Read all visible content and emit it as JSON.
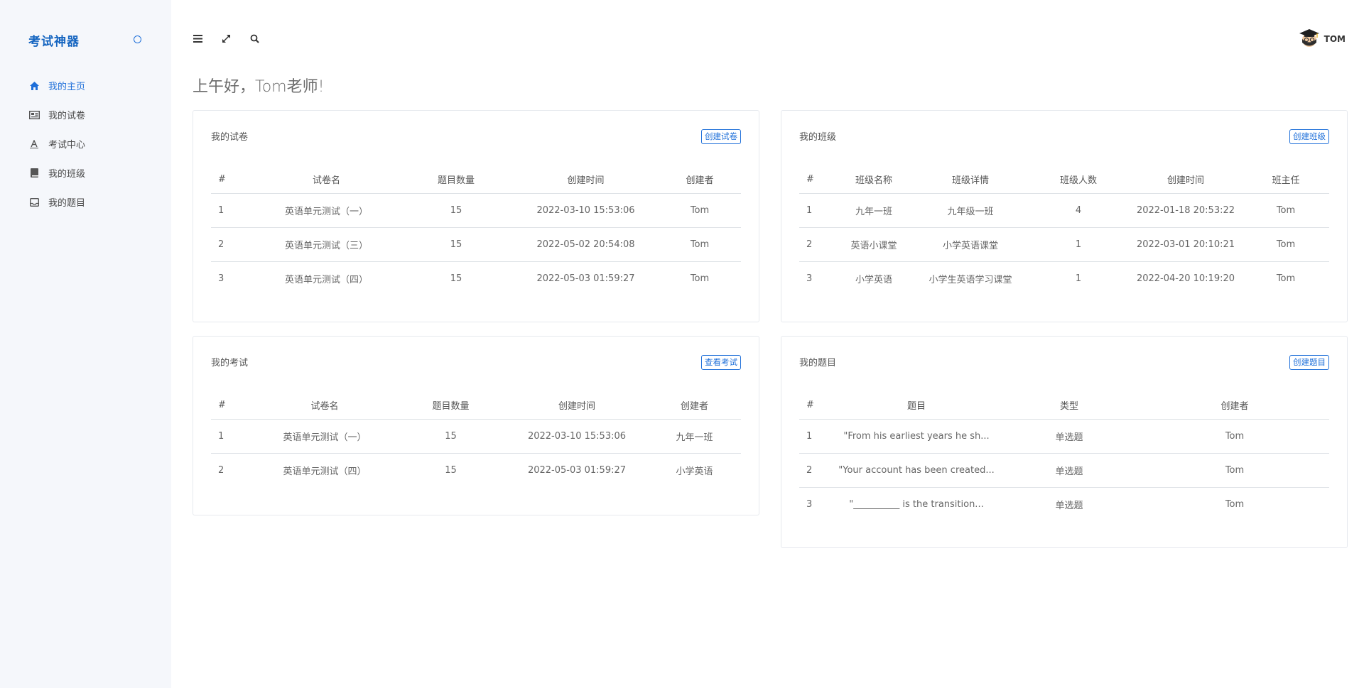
{
  "app": {
    "brand": "考试神器"
  },
  "sidebar": {
    "items": [
      {
        "label": "我的主页",
        "icon": "home-icon",
        "active": true
      },
      {
        "label": "我的试卷",
        "icon": "paper-icon",
        "active": false
      },
      {
        "label": "考试中心",
        "icon": "exam-icon",
        "active": false
      },
      {
        "label": "我的班级",
        "icon": "book-icon",
        "active": false
      },
      {
        "label": "我的题目",
        "icon": "inbox-icon",
        "active": false
      }
    ]
  },
  "header": {
    "icons": [
      "menu-icon",
      "fullscreen-icon",
      "search-icon"
    ],
    "user_name": "TOM"
  },
  "greeting": "上午好，Tom老师!",
  "colors": {
    "accent": "#1e6fd9",
    "sidebar_bg": "#f5f7fb"
  },
  "cards": {
    "papers": {
      "title": "我的试卷",
      "button": "创建试卷",
      "columns": [
        "#",
        "试卷名",
        "题目数量",
        "创建时间",
        "创建者"
      ],
      "rows": [
        [
          "1",
          "英语单元测试（一）",
          "15",
          "2022-03-10 15:53:06",
          "Tom"
        ],
        [
          "2",
          "英语单元测试（三）",
          "15",
          "2022-05-02 20:54:08",
          "Tom"
        ],
        [
          "3",
          "英语单元测试（四）",
          "15",
          "2022-05-03 01:59:27",
          "Tom"
        ]
      ]
    },
    "classes": {
      "title": "我的班级",
      "button": "创建班级",
      "columns": [
        "#",
        "班级名称",
        "班级详情",
        "班级人数",
        "创建时间",
        "班主任"
      ],
      "rows": [
        [
          "1",
          "九年一班",
          "九年级一班",
          "4",
          "2022-01-18 20:53:22",
          "Tom"
        ],
        [
          "2",
          "英语小课堂",
          "小学英语课堂",
          "1",
          "2022-03-01 20:10:21",
          "Tom"
        ],
        [
          "3",
          "小学英语",
          "小学生英语学习课堂",
          "1",
          "2022-04-20 10:19:20",
          "Tom"
        ]
      ]
    },
    "exams": {
      "title": "我的考试",
      "button": "查看考试",
      "columns": [
        "#",
        "试卷名",
        "题目数量",
        "创建时间",
        "创建者"
      ],
      "rows": [
        [
          "1",
          "英语单元测试（一）",
          "15",
          "2022-03-10 15:53:06",
          "九年一班"
        ],
        [
          "2",
          "英语单元测试（四）",
          "15",
          "2022-05-03 01:59:27",
          "小学英语"
        ]
      ]
    },
    "questions": {
      "title": "我的题目",
      "button": "创建题目",
      "columns": [
        "#",
        "题目",
        "类型",
        "创建者"
      ],
      "rows": [
        [
          "1",
          "\"From his earliest years he sh...",
          "单选题",
          "Tom"
        ],
        [
          "2",
          "\"Your account has been created...",
          "单选题",
          "Tom"
        ],
        [
          "3",
          "\"__________ is the transition...",
          "单选题",
          "Tom"
        ]
      ]
    }
  }
}
